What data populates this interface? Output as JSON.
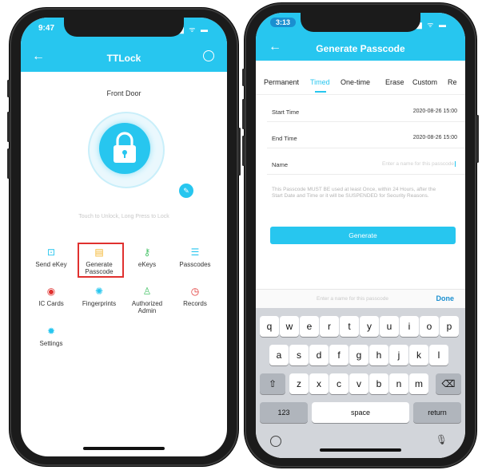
{
  "left_phone": {
    "status_time": "9:47",
    "status_icons": "▂▄▆ ᯤ ▬",
    "nav_title": "TTLock",
    "lock_name": "Front Door",
    "unlock_hint": "Touch to Unlock, Long Press to Lock",
    "grid": [
      {
        "label": "Send eKey",
        "icon": "send-ekey-icon",
        "glyph": "⊡",
        "color": "#27c6ef"
      },
      {
        "label": "Generate Passcode",
        "icon": "passcode-icon",
        "glyph": "▤",
        "color": "#f3b52b"
      },
      {
        "label": "eKeys",
        "icon": "ekeys-icon",
        "glyph": "⚷",
        "color": "#4bc46b"
      },
      {
        "label": "Passcodes",
        "icon": "passcodes-icon",
        "glyph": "☰",
        "color": "#27c6ef"
      },
      {
        "label": "IC Cards",
        "icon": "ic-card-icon",
        "glyph": "◉",
        "color": "#e0312f"
      },
      {
        "label": "Fingerprints",
        "icon": "fingerprint-icon",
        "glyph": "✺",
        "color": "#27c6ef"
      },
      {
        "label": "Authorized Admin",
        "icon": "admin-icon",
        "glyph": "♙",
        "color": "#4bc46b"
      },
      {
        "label": "Records",
        "icon": "records-icon",
        "glyph": "◷",
        "color": "#e0312f"
      },
      {
        "label": "Settings",
        "icon": "settings-icon",
        "glyph": "✹",
        "color": "#27c6ef"
      }
    ]
  },
  "right_phone": {
    "status_time": "3:13",
    "nav_title": "Generate Passcode",
    "tabs": [
      "Permanent",
      "Timed",
      "One-time",
      "Erase",
      "Custom",
      "Re"
    ],
    "active_tab": "Timed",
    "start_time_label": "Start Time",
    "start_time_value": "2020-08-26 15:00",
    "end_time_label": "End Time",
    "end_time_value": "2020-08-26 15:00",
    "name_label": "Name",
    "name_placeholder": "Enter a name for this passcode",
    "notice": "This Passcode MUST BE used at least Once, within 24 Hours, after the Start Date and Time or it will be SUSPENDED for Security Reasons.",
    "generate_label": "Generate",
    "accessory_placeholder": "Enter a name for this passcode",
    "done_label": "Done",
    "keyboard": {
      "row1": [
        "q",
        "w",
        "e",
        "r",
        "t",
        "y",
        "u",
        "i",
        "o",
        "p"
      ],
      "row2": [
        "a",
        "s",
        "d",
        "f",
        "g",
        "h",
        "j",
        "k",
        "l"
      ],
      "row3": [
        "z",
        "x",
        "c",
        "v",
        "b",
        "n",
        "m"
      ],
      "num": "123",
      "space": "space",
      "return": "return"
    }
  },
  "colors": {
    "accent": "#27c6ef",
    "highlight": "#e0312f"
  }
}
